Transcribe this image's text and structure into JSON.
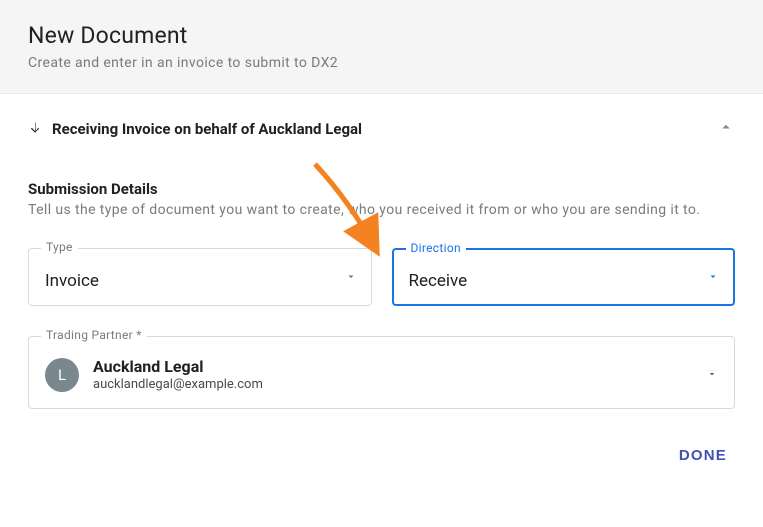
{
  "header": {
    "title": "New Document",
    "subtitle": "Create and enter in an invoice to submit to DX2"
  },
  "accordion": {
    "title": "Receiving Invoice on behalf of Auckland Legal"
  },
  "submission": {
    "title": "Submission Details",
    "subtitle": "Tell us the type of document you want to create, who you received it from or who you are sending it to."
  },
  "fields": {
    "type": {
      "label": "Type",
      "value": "Invoice"
    },
    "direction": {
      "label": "Direction",
      "value": "Receive"
    },
    "trading_partner": {
      "label": "Trading Partner *",
      "initial": "L",
      "name": "Auckland Legal",
      "email": "aucklandlegal@example.com"
    }
  },
  "actions": {
    "done": "DONE"
  }
}
